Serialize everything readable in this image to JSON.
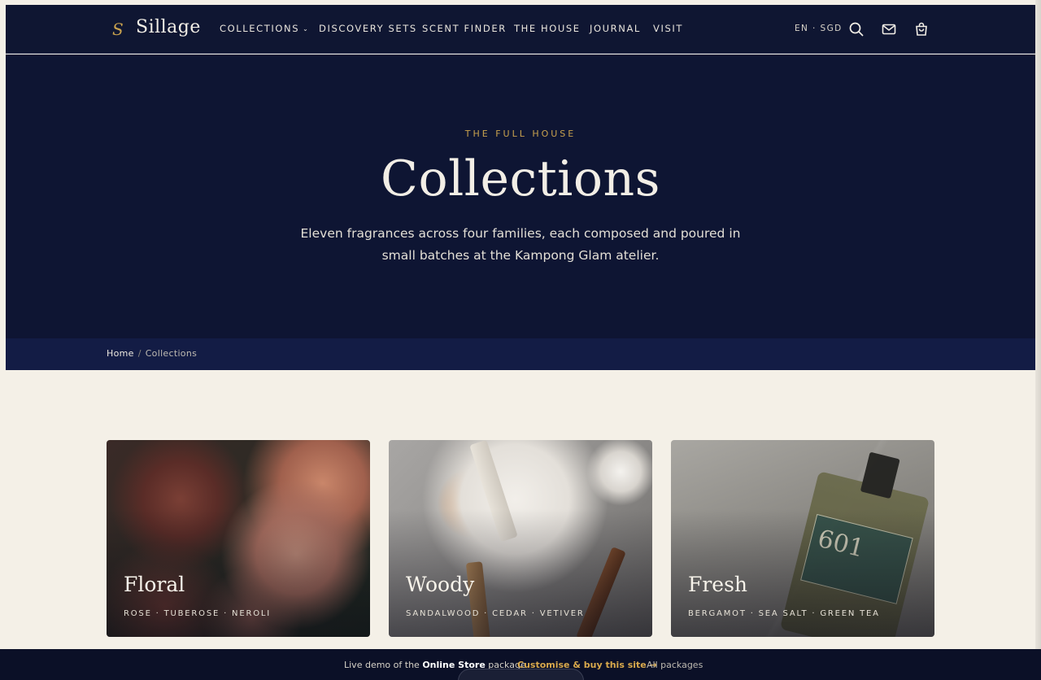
{
  "brand": {
    "mark": "S",
    "name": "Sillage",
    "accent": "#c9a24e",
    "navy": "#0e1533"
  },
  "nav": {
    "items": [
      {
        "label": "COLLECTIONS",
        "has_dropdown": true
      },
      {
        "label": "DISCOVERY SETS"
      },
      {
        "label": "SCENT FINDER"
      },
      {
        "label": "THE HOUSE"
      },
      {
        "label": "JOURNAL"
      },
      {
        "label": "VISIT"
      }
    ],
    "locale": "EN · SGD",
    "icons": [
      "search-icon",
      "mail-icon",
      "bag-icon"
    ]
  },
  "hero": {
    "eyebrow": "THE FULL HOUSE",
    "title": "Collections",
    "description": "Eleven fragrances across four families, each composed and poured in small batches at the Kampong Glam atelier."
  },
  "breadcrumb": {
    "home": "Home",
    "separator": "/",
    "current": "Collections"
  },
  "cards": [
    {
      "title": "Floral",
      "notes": "ROSE · TUBEROSE · NEROLI"
    },
    {
      "title": "Woody",
      "notes": "SANDALWOOD · CEDAR · VETIVER"
    },
    {
      "title": "Fresh",
      "notes": "BERGAMOT · SEA SALT · GREEN TEA"
    }
  ],
  "bottle_label": "601",
  "demo_bar": {
    "prefix": "Live demo of the ",
    "package": "Online Store",
    "suffix": " package",
    "cta": "Customise & buy this site →",
    "all": "All packages"
  }
}
